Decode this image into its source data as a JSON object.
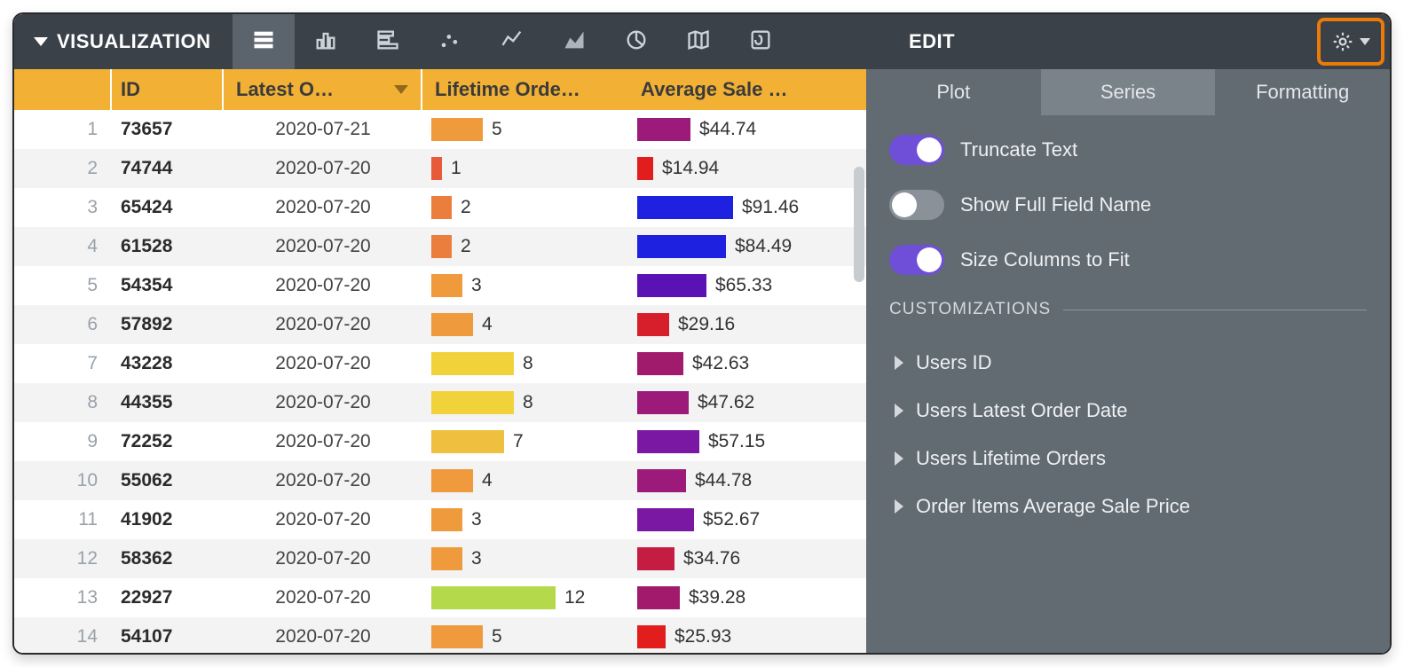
{
  "topbar": {
    "title": "VISUALIZATION",
    "edit_label": "EDIT",
    "vis_types": [
      {
        "name": "table-icon",
        "active": true
      },
      {
        "name": "column-chart-icon",
        "active": false
      },
      {
        "name": "bar-chart-icon",
        "active": false
      },
      {
        "name": "scatter-icon",
        "active": false
      },
      {
        "name": "line-icon",
        "active": false
      },
      {
        "name": "area-icon",
        "active": false
      },
      {
        "name": "pie-icon",
        "active": false
      },
      {
        "name": "map-icon",
        "active": false
      },
      {
        "name": "single-value-icon",
        "active": false
      }
    ]
  },
  "table": {
    "columns": {
      "id": "ID",
      "latest_order": "Latest O…",
      "lifetime_orders": "Lifetime Orde…",
      "average_sale": "Average Sale …"
    },
    "orders_max": 12,
    "avg_max": 100,
    "rows": [
      {
        "n": 1,
        "id": "73657",
        "date": "2020-07-21",
        "orders": 5,
        "orders_color": "#ef9a3c",
        "avg": "$44.74",
        "avg_w": 60,
        "avg_color": "#9b1a7a"
      },
      {
        "n": 2,
        "id": "74744",
        "date": "2020-07-20",
        "orders": 1,
        "orders_color": "#e75a3a",
        "avg": "$14.94",
        "avg_w": 18,
        "avg_color": "#e21d1d"
      },
      {
        "n": 3,
        "id": "65424",
        "date": "2020-07-20",
        "orders": 2,
        "orders_color": "#ec7e3d",
        "avg": "$91.46",
        "avg_w": 108,
        "avg_color": "#1e22e0"
      },
      {
        "n": 4,
        "id": "61528",
        "date": "2020-07-20",
        "orders": 2,
        "orders_color": "#ec7e3d",
        "avg": "$84.49",
        "avg_w": 100,
        "avg_color": "#1e22e0"
      },
      {
        "n": 5,
        "id": "54354",
        "date": "2020-07-20",
        "orders": 3,
        "orders_color": "#ef9a3c",
        "avg": "$65.33",
        "avg_w": 78,
        "avg_color": "#5b12b5"
      },
      {
        "n": 6,
        "id": "57892",
        "date": "2020-07-20",
        "orders": 4,
        "orders_color": "#ef9a3c",
        "avg": "$29.16",
        "avg_w": 36,
        "avg_color": "#d61f2a"
      },
      {
        "n": 7,
        "id": "43228",
        "date": "2020-07-20",
        "orders": 8,
        "orders_color": "#f2d23b",
        "avg": "$42.63",
        "avg_w": 52,
        "avg_color": "#a21a6c"
      },
      {
        "n": 8,
        "id": "44355",
        "date": "2020-07-20",
        "orders": 8,
        "orders_color": "#f2d23b",
        "avg": "$47.62",
        "avg_w": 58,
        "avg_color": "#9b1a7a"
      },
      {
        "n": 9,
        "id": "72252",
        "date": "2020-07-20",
        "orders": 7,
        "orders_color": "#efc040",
        "avg": "$57.15",
        "avg_w": 70,
        "avg_color": "#7a17a3"
      },
      {
        "n": 10,
        "id": "55062",
        "date": "2020-07-20",
        "orders": 4,
        "orders_color": "#ef9a3c",
        "avg": "$44.78",
        "avg_w": 55,
        "avg_color": "#9b1a7a"
      },
      {
        "n": 11,
        "id": "41902",
        "date": "2020-07-20",
        "orders": 3,
        "orders_color": "#ef9a3c",
        "avg": "$52.67",
        "avg_w": 64,
        "avg_color": "#7a17a3"
      },
      {
        "n": 12,
        "id": "58362",
        "date": "2020-07-20",
        "orders": 3,
        "orders_color": "#ef9a3c",
        "avg": "$34.76",
        "avg_w": 42,
        "avg_color": "#c51d41"
      },
      {
        "n": 13,
        "id": "22927",
        "date": "2020-07-20",
        "orders": 12,
        "orders_color": "#b4d94a",
        "avg": "$39.28",
        "avg_w": 48,
        "avg_color": "#a21a6c"
      },
      {
        "n": 14,
        "id": "54107",
        "date": "2020-07-20",
        "orders": 5,
        "orders_color": "#ef9a3c",
        "avg": "$25.93",
        "avg_w": 32,
        "avg_color": "#e21d1d"
      }
    ]
  },
  "panel": {
    "tabs": {
      "plot": "Plot",
      "series": "Series",
      "formatting": "Formatting"
    },
    "active_tab": "series",
    "toggles": [
      {
        "key": "truncate",
        "label": "Truncate Text",
        "on": true
      },
      {
        "key": "fullfield",
        "label": "Show Full Field Name",
        "on": false
      },
      {
        "key": "sizefit",
        "label": "Size Columns to Fit",
        "on": true
      }
    ],
    "customizations_label": "CUSTOMIZATIONS",
    "customizations": [
      "Users ID",
      "Users Latest Order Date",
      "Users Lifetime Orders",
      "Order Items Average Sale Price"
    ]
  }
}
